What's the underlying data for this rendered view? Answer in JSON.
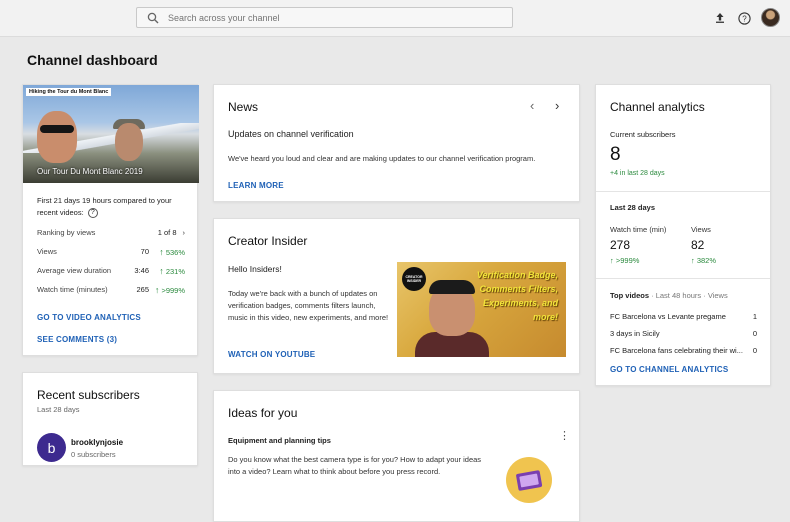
{
  "topbar": {
    "search_placeholder": "Search across your channel",
    "icons": [
      "search-icon",
      "upload-icon",
      "help-icon",
      "avatar"
    ]
  },
  "page": {
    "title": "Channel dashboard"
  },
  "latest_video": {
    "thumb_tag": "Hiking the Tour du Mont Blanc",
    "title": "Our Tour Du Mont Blanc 2019",
    "summary": "First 21 days 19 hours compared to your recent videos:",
    "ranking_label": "Ranking by views",
    "ranking_value": "1 of 8",
    "stats": [
      {
        "label": "Views",
        "value": "70",
        "change": "536%"
      },
      {
        "label": "Average view duration",
        "value": "3:46",
        "change": "231%"
      },
      {
        "label": "Watch time (minutes)",
        "value": "265",
        "change": ">999%"
      }
    ],
    "link_analytics": "GO TO VIDEO ANALYTICS",
    "link_comments": "SEE COMMENTS (3)"
  },
  "recent_subscribers": {
    "title": "Recent subscribers",
    "period": "Last 28 days",
    "subscriber": {
      "initial": "b",
      "name": "brooklynjosie",
      "count": "0 subscribers"
    }
  },
  "news": {
    "title": "News",
    "headline": "Updates on channel verification",
    "body": "We've heard you loud and clear and are making updates to our channel verification program.",
    "link": "LEARN MORE"
  },
  "creator_insider": {
    "title": "Creator Insider",
    "greeting": "Hello Insiders!",
    "body": "Today we're back with a bunch of updates on verification badges, comments filters launch, music in this video, new experiments, and more!",
    "link": "WATCH ON YOUTUBE",
    "image_logo": "CREATOR INSIDER",
    "image_text": "Verification Badge, Comments Filters, Experiments, and more!"
  },
  "ideas": {
    "title": "Ideas for you",
    "topic": "Equipment and planning tips",
    "body": "Do you know what the best camera type is for you? How to adapt your ideas into a video? Learn what to think about before you press record."
  },
  "analytics": {
    "title": "Channel analytics",
    "current_label": "Current subscribers",
    "current_value": "8",
    "current_change": "+4 in last 28 days",
    "period_title": "Last 28 days",
    "metrics": [
      {
        "label": "Watch time (min)",
        "value": "278",
        "change": ">999%"
      },
      {
        "label": "Views",
        "value": "82",
        "change": "382%"
      }
    ],
    "top_videos_title": "Top videos",
    "top_videos_period": "· Last 48 hours · Views",
    "top_videos": [
      {
        "title": "FC Barcelona vs Levante pregame",
        "views": "1"
      },
      {
        "title": "3 days in Sicily",
        "views": "0"
      },
      {
        "title": "FC Barcelona fans celebrating their wi...",
        "views": "0"
      }
    ],
    "link": "GO TO CHANNEL ANALYTICS"
  },
  "colors": {
    "link": "#1f61b6",
    "positive": "#2b8a3e",
    "background": "#e9e9e9"
  }
}
